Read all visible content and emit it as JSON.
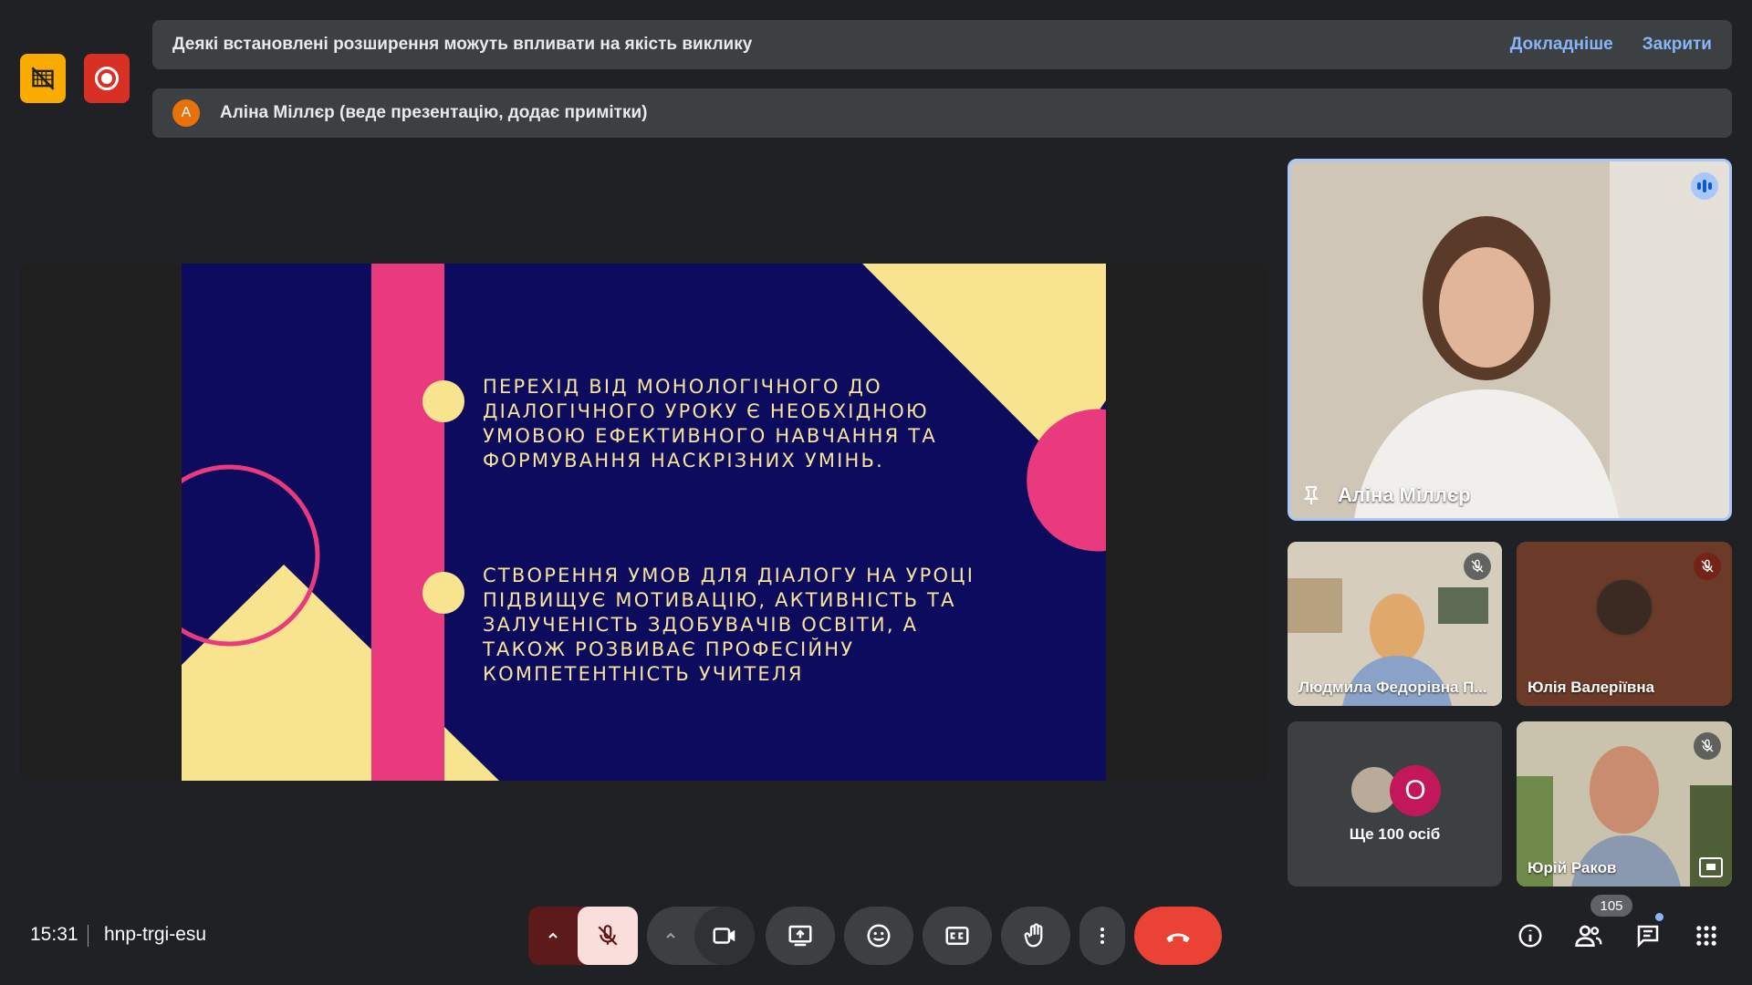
{
  "notifications": {
    "warning_text": "Деякі встановлені розширення можуть впливати на якість виклику",
    "learn_more_label": "Докладніше",
    "close_label": "Закрити",
    "presenter_initial": "A",
    "presenter_text": "Аліна Міллєр (веде презентацію, додає примітки)"
  },
  "slide": {
    "point1": "Перехід від монологічного до діалогічного уроку є необхідною умовою ефективного навчання та формування наскрізних умінь.",
    "point2": "Створення умов для діалогу на уроці підвищує мотивацію, активність та залученість здобувачів освіти, а також розвиває професійну компетентність учителя"
  },
  "participants": {
    "main_name": "Аліна Міллєр",
    "tile1_name": "Людмила Федорівна П...",
    "tile2_name": "Юлія Валеріївна",
    "more_initial": "О",
    "more_label": "Ще 100 осіб",
    "tile4_name": "Юрій Раков"
  },
  "footer": {
    "time": "15:31",
    "meeting_code": "hnp-trgi-esu",
    "participant_count": "105"
  },
  "colors": {
    "slide_bg": "#0c0b5e",
    "slide_pink": "#e93a7d",
    "slide_yellow": "#f8e38f",
    "end_call": "#ea4335",
    "rec": "#d93025",
    "warn": "#f9ab00"
  },
  "icons": {
    "ext": "extension-off-icon",
    "rec": "record-icon",
    "mic": "mic-off-icon",
    "cam": "camera-icon",
    "present": "present-screen-icon",
    "emoji": "emoji-icon",
    "cc": "captions-icon",
    "hand": "raise-hand-icon",
    "more": "more-vert-icon",
    "end": "end-call-icon",
    "info": "info-icon",
    "people": "people-icon",
    "chat": "chat-icon",
    "apps": "apps-grid-icon"
  }
}
